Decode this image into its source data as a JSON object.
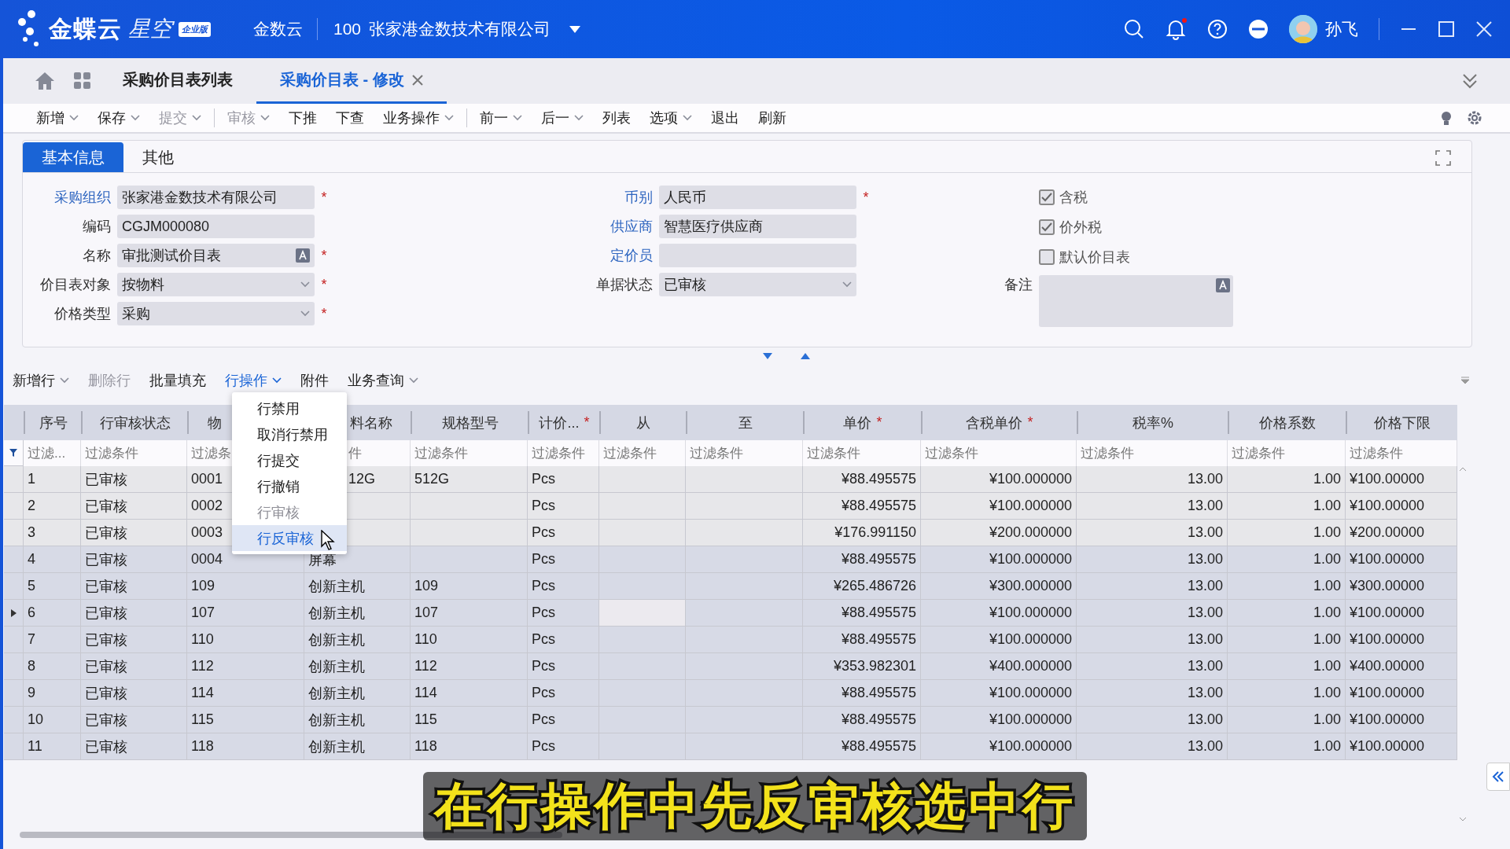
{
  "app": {
    "logo": "金蝶云",
    "logo_sub": "星空",
    "edition": "企业版",
    "tenant": "金数云",
    "org_code": "100",
    "org_name": "张家港金数技术有限公司",
    "user": "孙飞"
  },
  "tabs": [
    {
      "label": "采购价目表列表",
      "selected": false,
      "closable": false
    },
    {
      "label": "采购价目表 - 修改",
      "selected": true,
      "closable": true
    }
  ],
  "toolbar": [
    {
      "label": "新增",
      "dropdown": true,
      "disabled": false
    },
    {
      "label": "保存",
      "dropdown": true,
      "disabled": false
    },
    {
      "label": "提交",
      "dropdown": true,
      "disabled": true
    },
    {
      "label": "审核",
      "dropdown": true,
      "disabled": true,
      "sep_before": true
    },
    {
      "label": "下推",
      "dropdown": false,
      "disabled": false
    },
    {
      "label": "下查",
      "dropdown": false,
      "disabled": false
    },
    {
      "label": "业务操作",
      "dropdown": true,
      "disabled": false
    },
    {
      "label": "前一",
      "dropdown": true,
      "disabled": false,
      "sep_before": true
    },
    {
      "label": "后一",
      "dropdown": true,
      "disabled": false
    },
    {
      "label": "列表",
      "dropdown": false,
      "disabled": false
    },
    {
      "label": "选项",
      "dropdown": true,
      "disabled": false
    },
    {
      "label": "退出",
      "dropdown": false,
      "disabled": false
    },
    {
      "label": "刷新",
      "dropdown": false,
      "disabled": false
    }
  ],
  "form_tabs": [
    {
      "label": "基本信息",
      "selected": true
    },
    {
      "label": "其他",
      "selected": false
    }
  ],
  "form": {
    "columns": [
      [
        {
          "label": "采购组织",
          "value": "张家港金数技术有限公司",
          "kind": "text",
          "link": true,
          "required": true
        },
        {
          "label": "编码",
          "value": "CGJM000080",
          "kind": "text",
          "link": false,
          "required": false
        },
        {
          "label": "名称",
          "value": "审批测试价目表",
          "kind": "multilang",
          "link": false,
          "required": true
        },
        {
          "label": "价目表对象",
          "value": "按物料",
          "kind": "select",
          "link": false,
          "required": true
        },
        {
          "label": "价格类型",
          "value": "采购",
          "kind": "select",
          "link": false,
          "required": true
        }
      ],
      [
        {
          "label": "币别",
          "value": "人民币",
          "kind": "text",
          "link": true,
          "required": true
        },
        {
          "label": "供应商",
          "value": "智慧医疗供应商",
          "kind": "text",
          "link": true,
          "required": false
        },
        {
          "label": "定价员",
          "kind": "text",
          "link": true,
          "required": false
        },
        {
          "label": "单据状态",
          "value": "已审核",
          "kind": "select",
          "link": false,
          "required": false
        }
      ]
    ],
    "checkboxes": [
      {
        "label": "含税",
        "checked": true
      },
      {
        "label": "价外税",
        "checked": true
      },
      {
        "label": "默认价目表",
        "checked": false
      }
    ],
    "remark": {
      "label": "备注"
    }
  },
  "grid_toolbar": [
    {
      "label": "新增行",
      "dropdown": true,
      "disabled": false,
      "active": false
    },
    {
      "label": "删除行",
      "dropdown": false,
      "disabled": true,
      "active": false
    },
    {
      "label": "批量填充",
      "dropdown": false,
      "disabled": false,
      "active": false
    },
    {
      "label": "行操作",
      "dropdown": true,
      "disabled": false,
      "active": true
    },
    {
      "label": "附件",
      "dropdown": false,
      "disabled": false,
      "active": false
    },
    {
      "label": "业务查询",
      "dropdown": true,
      "disabled": false,
      "active": false
    }
  ],
  "menu": [
    {
      "label": "行禁用",
      "disabled": false,
      "selected": false
    },
    {
      "label": "取消行禁用",
      "disabled": false,
      "selected": false
    },
    {
      "label": "行提交",
      "disabled": false,
      "selected": false
    },
    {
      "label": "行撤销",
      "disabled": false,
      "selected": false
    },
    {
      "label": "行审核",
      "disabled": true,
      "selected": false
    },
    {
      "label": "行反审核",
      "disabled": false,
      "selected": true
    }
  ],
  "grid": {
    "columns": [
      {
        "label": "序号",
        "required": false
      },
      {
        "label": "行审核状态",
        "required": false
      },
      {
        "label": "物",
        "required": false
      },
      {
        "label": "料名称",
        "required": false
      },
      {
        "label": "规格型号",
        "required": false
      },
      {
        "label": "计价...",
        "required": true
      },
      {
        "label": "从",
        "required": false
      },
      {
        "label": "至",
        "required": false
      },
      {
        "label": "单价",
        "required": true
      },
      {
        "label": "含税单价",
        "required": true
      },
      {
        "label": "税率%",
        "required": false
      },
      {
        "label": "价格系数",
        "required": false
      },
      {
        "label": "价格下限",
        "required": false
      }
    ],
    "filters": [
      "过滤...",
      "过滤条件",
      "过滤条",
      "件",
      "过滤条件",
      "过滤条件",
      "过滤条件",
      "过滤条件",
      "过滤条件",
      "过滤条件",
      "过滤条件",
      "过滤条件",
      "过滤条件"
    ],
    "rows": [
      {
        "selected": false,
        "current": false,
        "cells": [
          "1",
          "已审核",
          "0001",
          "12G",
          "512G",
          "Pcs",
          "",
          "",
          "¥88.495575",
          "¥100.000000",
          "13.00",
          "1.00",
          "¥100.00000"
        ]
      },
      {
        "selected": false,
        "current": false,
        "cells": [
          "2",
          "已审核",
          "0002",
          "",
          "",
          "Pcs",
          "",
          "",
          "¥88.495575",
          "¥100.000000",
          "13.00",
          "1.00",
          "¥100.00000"
        ]
      },
      {
        "selected": false,
        "current": false,
        "cells": [
          "3",
          "已审核",
          "0003",
          "",
          "",
          "Pcs",
          "",
          "",
          "¥176.991150",
          "¥200.000000",
          "13.00",
          "1.00",
          "¥200.00000"
        ]
      },
      {
        "selected": true,
        "current": false,
        "cells": [
          "4",
          "已审核",
          "0004",
          "屏幕",
          "",
          "Pcs",
          "",
          "",
          "¥88.495575",
          "¥100.000000",
          "13.00",
          "1.00",
          "¥100.00000"
        ]
      },
      {
        "selected": true,
        "current": false,
        "cells": [
          "5",
          "已审核",
          "109",
          "创新主机",
          "109",
          "Pcs",
          "",
          "",
          "¥265.486726",
          "¥300.000000",
          "13.00",
          "1.00",
          "¥300.00000"
        ]
      },
      {
        "selected": true,
        "current": true,
        "cells": [
          "6",
          "已审核",
          "107",
          "创新主机",
          "107",
          "Pcs",
          "",
          "",
          "¥88.495575",
          "¥100.000000",
          "13.00",
          "1.00",
          "¥100.00000"
        ]
      },
      {
        "selected": true,
        "current": false,
        "cells": [
          "7",
          "已审核",
          "110",
          "创新主机",
          "110",
          "Pcs",
          "",
          "",
          "¥88.495575",
          "¥100.000000",
          "13.00",
          "1.00",
          "¥100.00000"
        ]
      },
      {
        "selected": true,
        "current": false,
        "cells": [
          "8",
          "已审核",
          "112",
          "创新主机",
          "112",
          "Pcs",
          "",
          "",
          "¥353.982301",
          "¥400.000000",
          "13.00",
          "1.00",
          "¥400.00000"
        ]
      },
      {
        "selected": true,
        "current": false,
        "cells": [
          "9",
          "已审核",
          "114",
          "创新主机",
          "114",
          "Pcs",
          "",
          "",
          "¥88.495575",
          "¥100.000000",
          "13.00",
          "1.00",
          "¥100.00000"
        ]
      },
      {
        "selected": true,
        "current": false,
        "cells": [
          "10",
          "已审核",
          "115",
          "创新主机",
          "115",
          "Pcs",
          "",
          "",
          "¥88.495575",
          "¥100.000000",
          "13.00",
          "1.00",
          "¥100.00000"
        ]
      },
      {
        "selected": true,
        "current": false,
        "cells": [
          "11",
          "已审核",
          "118",
          "创新主机",
          "118",
          "Pcs",
          "",
          "",
          "¥88.495575",
          "¥100.000000",
          "13.00",
          "1.00",
          "¥100.00000"
        ]
      }
    ]
  },
  "caption": "在行操作中先反审核选中行",
  "required_mark": "*"
}
